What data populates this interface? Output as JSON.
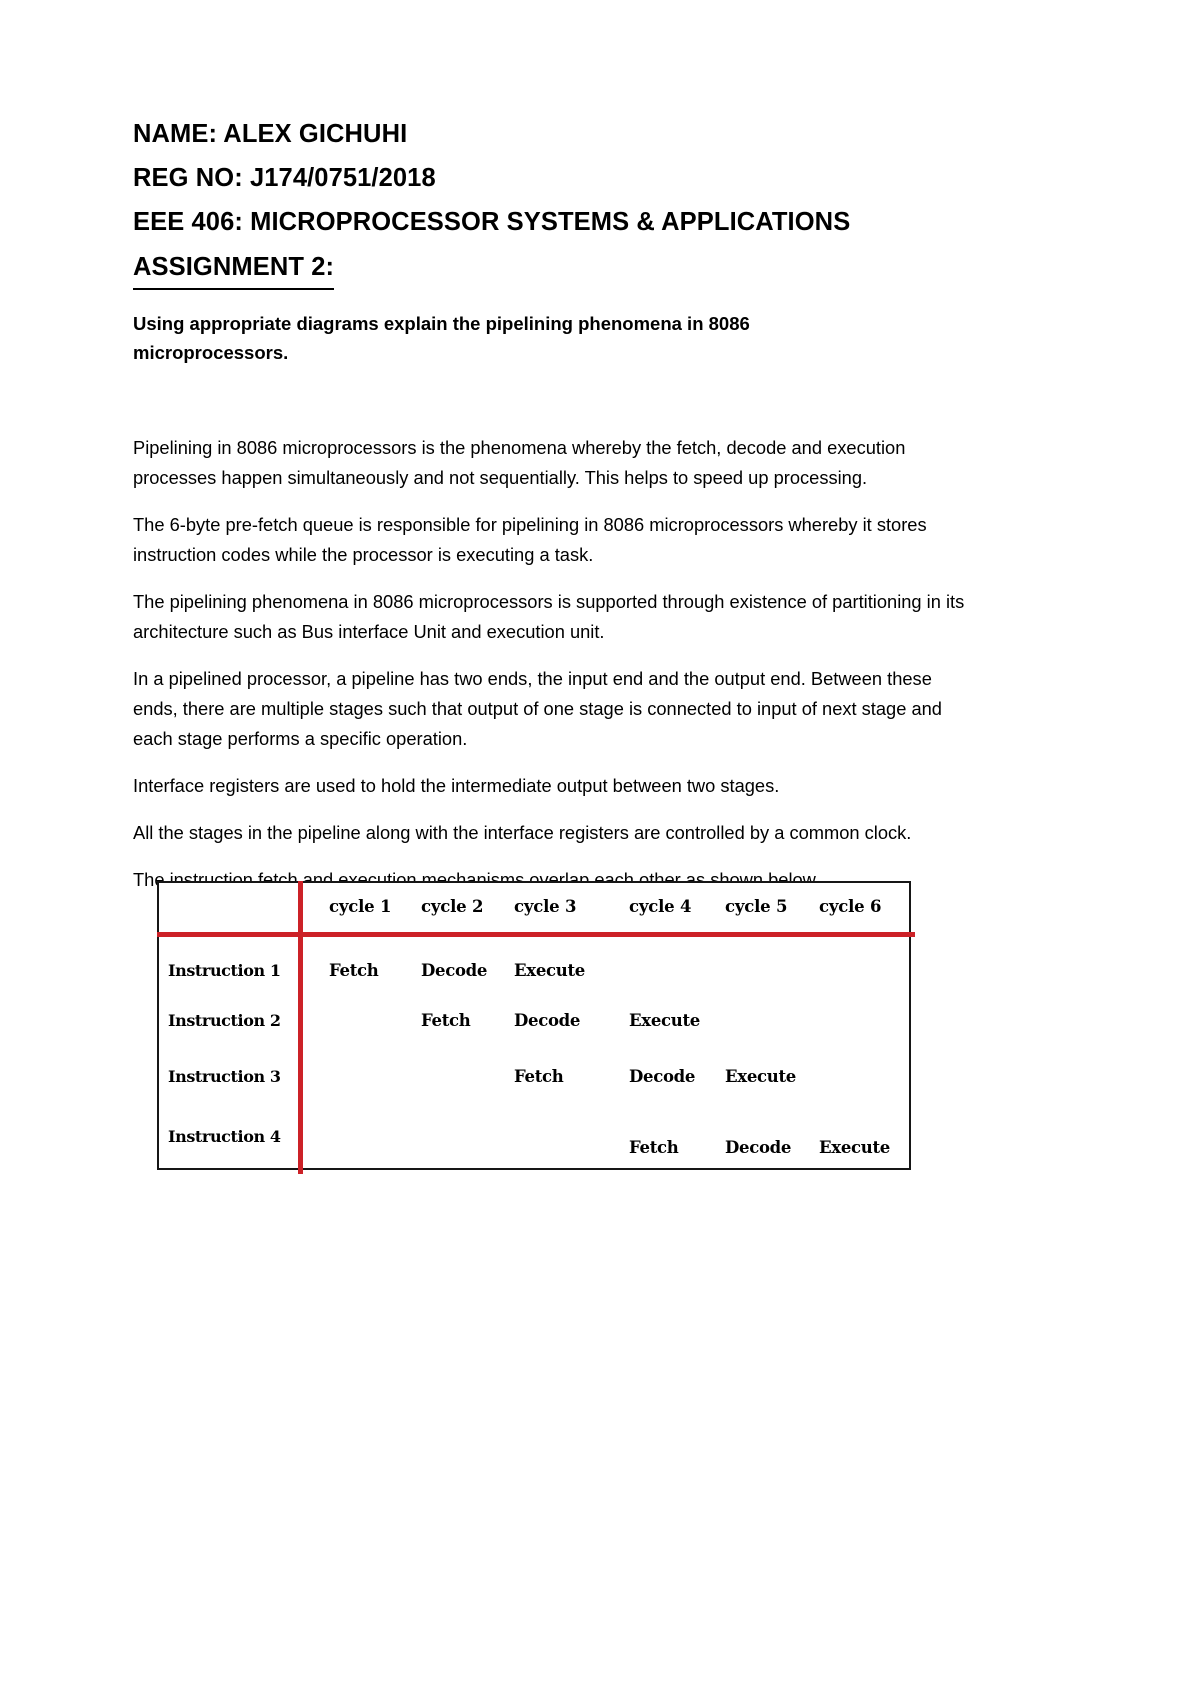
{
  "document": {
    "headings": [
      "NAME: ALEX GICHUHI",
      "REG NO: J174/0751/2018",
      "EEE 406: MICROPROCESSOR SYSTEMS & APPLICATIONS"
    ],
    "assignment_heading": "ASSIGNMENT 2:",
    "prompt": "Using appropriate diagrams explain the pipelining phenomena in 8086 microprocessors.",
    "paragraphs": [
      "Pipelining in 8086 microprocessors is the phenomena whereby the fetch, decode and execution processes happen simultaneously and not sequentially. This helps to speed up processing.",
      "The 6-byte pre-fetch queue is responsible for pipelining in 8086 microprocessors whereby it stores instruction codes while the processor is executing a task.",
      "The pipelining phenomena in 8086 microprocessors is supported through existence of partitioning in its architecture such as Bus interface Unit and execution unit.",
      "In a pipelined processor, a pipeline has two ends, the input end and the output end. Between these ends, there are multiple stages such that output of one stage is connected to input of next stage and each stage performs a specific operation.",
      "Interface registers are used to hold the intermediate output between two stages.",
      "All the stages in the pipeline along with the interface registers are controlled by a common clock.",
      "The instruction fetch and execution mechanisms overlap each other as shown below."
    ]
  },
  "pipeline_table": {
    "corner_label": "",
    "columns": [
      "cycle 1",
      "cycle 2",
      "cycle 3",
      "cycle 4",
      "cycle 5",
      "cycle 6"
    ],
    "rows": [
      {
        "label": "Instruction 1",
        "cells": [
          "Fetch",
          "Decode",
          "Execute",
          "",
          "",
          ""
        ]
      },
      {
        "label": "Instruction 2",
        "cells": [
          "",
          "Fetch",
          "Decode",
          "Execute",
          "",
          ""
        ]
      },
      {
        "label": "Instruction 3",
        "cells": [
          "",
          "",
          "Fetch",
          "Decode",
          "Execute",
          ""
        ]
      },
      {
        "label": "Instruction 4",
        "cells": [
          "",
          "",
          "",
          "Fetch",
          "Decode",
          "Execute"
        ]
      }
    ],
    "accent_color": "#cc2127",
    "border_color": "#161616"
  }
}
